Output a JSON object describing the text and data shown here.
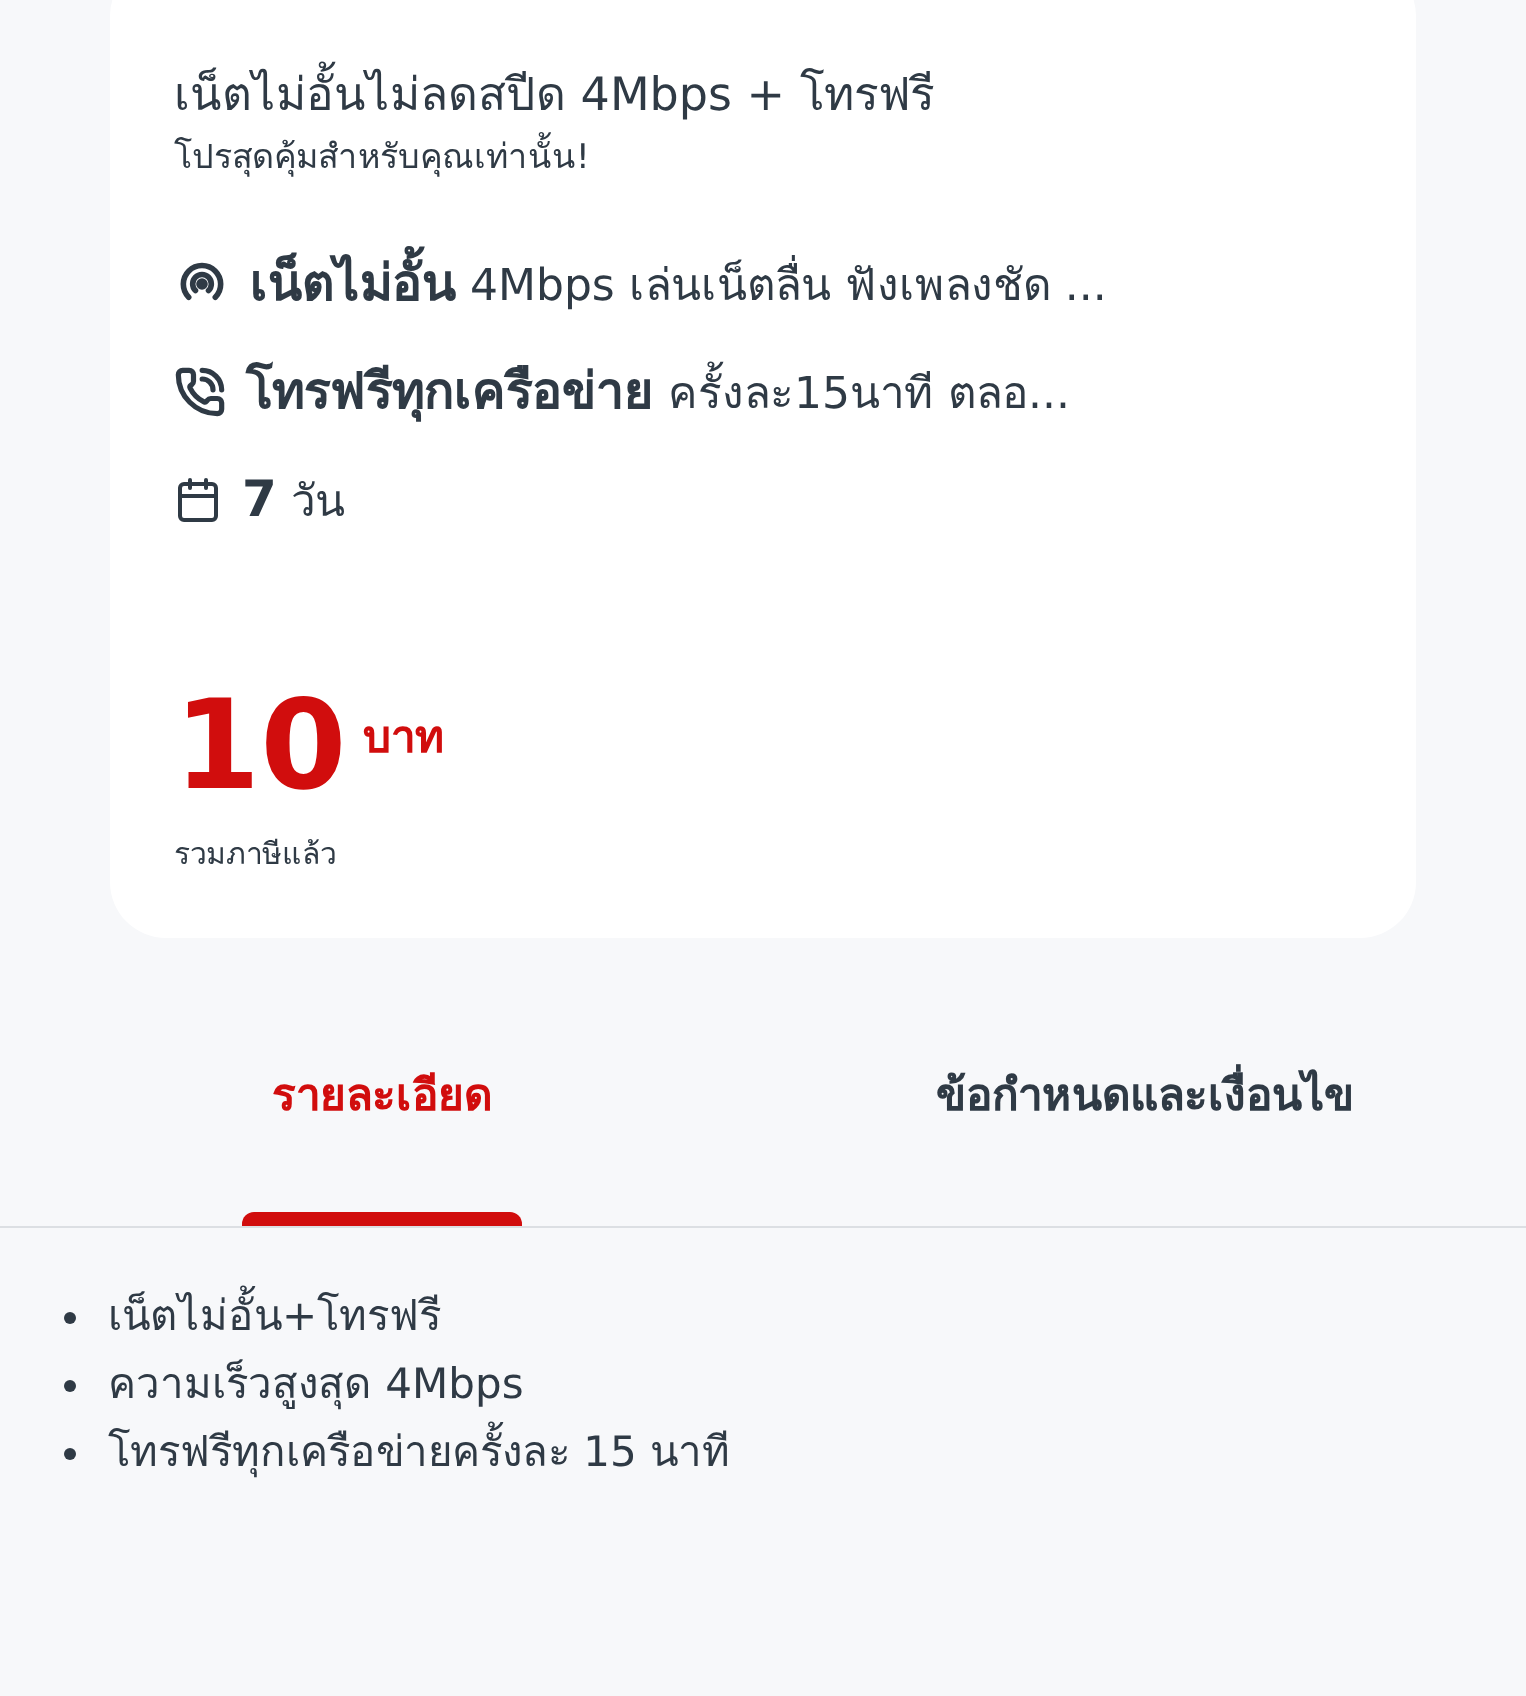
{
  "package": {
    "title": "เน็ตไม่อั้นไม่ลดสปีด 4Mbps + โทรฟรี",
    "subtitle": "โปรสุดคุ้มสำหรับคุณเท่านั้น!",
    "features": [
      {
        "kind": "data",
        "label": "เน็ตไม่อั้น",
        "detail": "4Mbps เล่นเน็ตลื่น ฟังเพลงชัด ..."
      },
      {
        "kind": "call",
        "label": "โทรฟรีทุกเครือข่าย",
        "detail": "ครั้งละ15นาที ตลอ..."
      },
      {
        "kind": "days",
        "label": "7",
        "detail": "วัน"
      }
    ],
    "price": "10",
    "currency": "บาท",
    "price_note": "รวมภาษีแล้ว"
  },
  "tabs": [
    {
      "label": "รายละเอียด",
      "selected": true
    },
    {
      "label": "ข้อกำหนดและเงื่อนไข",
      "selected": false
    }
  ],
  "details": [
    "เน็ตไม่อั้น+โทรฟรี",
    "ความเร็วสูงสุด 4Mbps",
    "โทรฟรีทุกเครือข่ายครั้งละ 15 นาที"
  ]
}
